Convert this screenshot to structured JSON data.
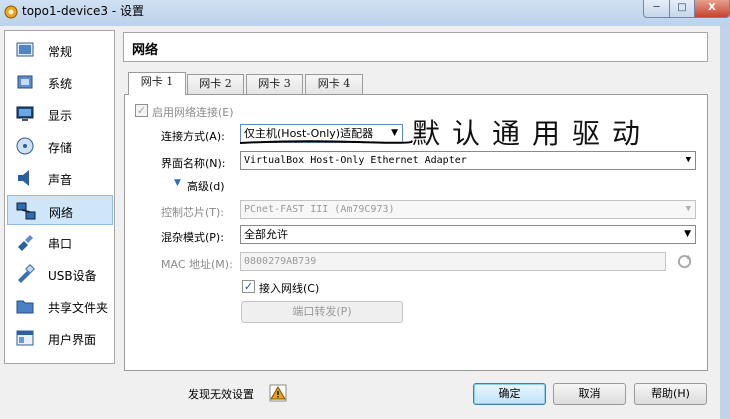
{
  "window": {
    "title": "topo1-device3 - 设置",
    "minimize": "─",
    "maximize": "□",
    "close": "X"
  },
  "sidebar": {
    "items": [
      {
        "label": "常规",
        "icon": "general-icon"
      },
      {
        "label": "系统",
        "icon": "system-icon"
      },
      {
        "label": "显示",
        "icon": "display-icon"
      },
      {
        "label": "存储",
        "icon": "storage-icon"
      },
      {
        "label": "声音",
        "icon": "audio-icon"
      },
      {
        "label": "网络",
        "icon": "network-icon",
        "selected": true
      },
      {
        "label": "串口",
        "icon": "serial-port-icon"
      },
      {
        "label": "USB设备",
        "icon": "usb-icon"
      },
      {
        "label": "共享文件夹",
        "icon": "shared-folder-icon"
      },
      {
        "label": "用户界面",
        "icon": "user-interface-icon"
      }
    ]
  },
  "header": {
    "title": "网络"
  },
  "tabs": [
    {
      "label": "网卡 1",
      "active": true
    },
    {
      "label": "网卡 2"
    },
    {
      "label": "网卡 3"
    },
    {
      "label": "网卡 4"
    }
  ],
  "adapter": {
    "enable_label": "启用网络连接(E)",
    "enable_checked": true,
    "attached_label": "连接方式(A):",
    "attached_value": "仅主机(Host-Only)适配器",
    "name_label": "界面名称(N):",
    "name_value": "VirtualBox Host-Only Ethernet Adapter",
    "advanced_label": "高级(d)",
    "adapter_type_label": "控制芯片(T):",
    "adapter_type_value": "PCnet-FAST III (Am79C973)",
    "promisc_label": "混杂模式(P):",
    "promisc_value": "全部允许",
    "mac_label": "MAC 地址(M):",
    "mac_value": "0800279AB739",
    "cable_label": "接入网线(C)",
    "cable_checked": true,
    "port_forward_label": "端口转发(P)"
  },
  "annotation": {
    "handwritten_text": "默认通用驱动"
  },
  "footer": {
    "invalid_settings_label": "发现无效设置",
    "ok_label": "确定",
    "cancel_label": "取消",
    "help_label": "帮助(H)"
  },
  "colors": {
    "selection": "#cfe5f8",
    "accent": "#3c7fb1",
    "warning": "#e8a317"
  }
}
